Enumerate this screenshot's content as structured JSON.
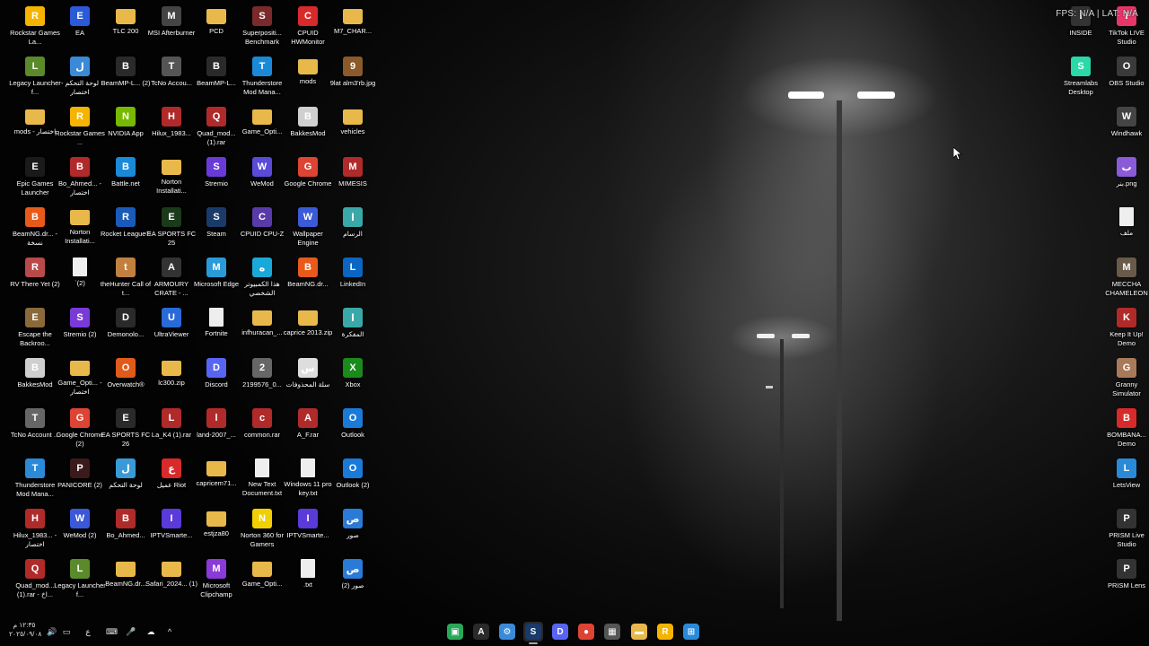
{
  "overlay": {
    "text": "FPS: N/A  |  LAT: N/A"
  },
  "desktop": {
    "left_columns": [
      [
        "Rockstar Games La...",
        "Legacy Launcher f...",
        "mods - اختصار",
        "Epic Games Launcher",
        "BeamNG.dr... - نسخة",
        "RV There Yet (2)",
        "Escape the Backroo...",
        "BakkesMod",
        "TcNo Account ...",
        "Thunderstore Mod Mana...",
        "Hilux_1983... - اختصار",
        "Quad_mod... (1).rar - اخ..."
      ],
      [
        "EA",
        "لوحة التحكم - اختصار",
        "Rockstar Games ...",
        "Bo_Ahmed... - اختصار",
        "Norton Installati...",
        "`(2)",
        "Stremio (2)",
        "Game_Opti... - اختصار",
        "Google Chrome (2)",
        "PANICORE (2)",
        "WeMod (2)",
        "Legacy Launcher f..."
      ],
      [
        "TLC 200",
        "BeamMP-L... (2)",
        "NVIDIA App",
        "Battle.net",
        "Rocket League®",
        "theHunter Call of t...",
        "Demonolo...",
        "Overwatch®",
        "EA SPORTS FC 26",
        "لوحة التحكم",
        "Bo_Ahmed...",
        "BeamNG.dr..."
      ],
      [
        "MSI Afterburner",
        "TcNo Accou...",
        "Hilux_1983...",
        "Norton Installati...",
        "EA SPORTS FC 25",
        "ARMOURY CRATE - ...",
        "UltraViewer",
        "lc300.zip",
        "La_K4 (1).rar",
        "عميل Riot",
        "IPTVSmarte...",
        "Safari_2024... (1)"
      ],
      [
        "PCD",
        "BeamMP-L...",
        "Quad_mod... (1).rar",
        "Stremio",
        "Steam",
        "Microsoft Edge",
        "Fortnite",
        "Discord",
        "land-2007_...",
        "capricem71...",
        "estjza80",
        "Microsoft Clipchamp"
      ],
      [
        "Superpositi... Benchmark",
        "Thunderstore Mod Mana...",
        "Game_Opti...",
        "WeMod",
        "CPUID CPU-Z",
        "هذا الكمبيوتر الشخصي",
        "infhuracan_...",
        "2199576_0...",
        "common.rar",
        "New Text Document.txt",
        "Norton 360 for Gamers",
        "Game_Opti..."
      ],
      [
        "CPUID HWMonitor",
        "mods",
        "BakkesMod",
        "Google Chrome",
        "Wallpaper Engine",
        "BeamNG.dr...",
        "caprice 2013.zip",
        "سلة المحذوفات",
        "A_F.rar",
        "Windows 11 pro key.txt",
        "IPTVSmarte...",
        ".txt"
      ],
      [
        "M7_CHAR...",
        "9lat alm3'rb.jpg",
        "vehicles",
        "MIMESIS",
        "الرسام",
        "LinkedIn",
        "المفكرة",
        "Xbox",
        "Outlook",
        "Outlook (2)",
        "صور",
        "صور (2)"
      ]
    ],
    "left_colors": [
      [
        "#f5b400",
        "#5a8a2a",
        "#e8b94a",
        "#1a1a1a",
        "#e85a1a",
        "#b84a4a",
        "#8a6a3a",
        "#cfcfcf",
        "#666",
        "#2a8ad8",
        "#b02a2a",
        "#b02a2a"
      ],
      [
        "#2a5ad8",
        "#3a8ad8",
        "#f5b400",
        "#b02a2a",
        "#e8b94a",
        "#eeeeee",
        "#7a3ad8",
        "#e8b94a",
        "#dd4433",
        "#3a1a1a",
        "#3a58d8",
        "#5a8a2a"
      ],
      [
        "#e8b94a",
        "#2a2a2a",
        "#76b900",
        "#1a8ad8",
        "#1a5ab8",
        "#c08040",
        "#2a2a2a",
        "#e05a1a",
        "#2a2a2a",
        "#3a9ad8",
        "#b02a2a",
        "#e8b94a"
      ],
      [
        "#444",
        "#555",
        "#b02a2a",
        "#e8b94a",
        "#1a3a1a",
        "#333",
        "#2a6ad8",
        "#e8b94a",
        "#b02a2a",
        "#d82a2a",
        "#5a3ad8",
        "#e8b94a"
      ],
      [
        "#e8b94a",
        "#2a2a2a",
        "#b02a2a",
        "#6a3ad8",
        "#1a3a6a",
        "#2a9ad8",
        "#eeeeee",
        "#5865f2",
        "#b02a2a",
        "#e8b94a",
        "#e8b94a",
        "#8a3ad8"
      ],
      [
        "#7a2a2a",
        "#1a8ad8",
        "#e8b94a",
        "#5a4ad8",
        "#5a3aa8",
        "#1aa8d8",
        "#e8b94a",
        "#666",
        "#b02a2a",
        "#eeeeee",
        "#f0d000",
        "#e8b94a"
      ],
      [
        "#d82a2a",
        "#e8b94a",
        "#cfcfcf",
        "#dd4433",
        "#3a5ad8",
        "#e85a1a",
        "#e8b94a",
        "#dddddd",
        "#b02a2a",
        "#eeeeee",
        "#5a3ad8",
        "#eeeeee"
      ],
      [
        "#e8b94a",
        "#8a5a2a",
        "#e8b94a",
        "#b02a2a",
        "#3aa8a8",
        "#0a66c2",
        "#3aa8a8",
        "#1a8a1a",
        "#1a7ad8",
        "#1a7ad8",
        "#2a7ad8",
        "#2a7ad8"
      ]
    ],
    "right_column": [
      "INSIDE",
      "Streamlabs Desktop",
      "Windhawk",
      "بنر.png",
      "ملف",
      "MECCHA CHAMELEON",
      "Keep It Up! Demo",
      "Granny Simulator",
      "BOMBANA... Demo",
      "LetsView",
      "PRISM Live Studio",
      "PRISM Lens"
    ],
    "right_column_2": [
      "TikTok LIVE Studio",
      "OBS Studio"
    ],
    "right_colors": [
      "#333",
      "#2ad8a8",
      "#444",
      "#8a5ad8",
      "#eeeeee",
      "#6a5a4a",
      "#b02a2a",
      "#a87a5a",
      "#d82a2a",
      "#2a8ad8",
      "#333",
      "#333"
    ],
    "right_colors_2": [
      "#e8356a",
      "#3a3a3a"
    ]
  },
  "taskbar": {
    "clock_time": "١٢:٣٥ م",
    "clock_date": "٢٠٢٥/٠٩/٠٨",
    "tray": {
      "volume": "🔊",
      "display": "▭",
      "lang": "ع",
      "network": "⌨",
      "mic": "🎤",
      "cloud": "☁",
      "chevron": "^"
    },
    "pinned": [
      {
        "name": "taskbar-app-1",
        "glyph": "▣",
        "color": "#2aa85a"
      },
      {
        "name": "taskbar-app-2",
        "glyph": "A",
        "color": "#2a2a2a"
      },
      {
        "name": "taskbar-app-3",
        "glyph": "⚙",
        "color": "#3a8ad8"
      },
      {
        "name": "taskbar-steam",
        "glyph": "S",
        "color": "#1a3a6a"
      },
      {
        "name": "taskbar-discord",
        "glyph": "D",
        "color": "#5865f2"
      },
      {
        "name": "taskbar-chrome",
        "glyph": "●",
        "color": "#dd4433"
      },
      {
        "name": "taskbar-store",
        "glyph": "▦",
        "color": "#555"
      },
      {
        "name": "taskbar-explorer",
        "glyph": "▬",
        "color": "#e8b94a"
      },
      {
        "name": "taskbar-rockstar",
        "glyph": "R",
        "color": "#f5b400"
      },
      {
        "name": "taskbar-start",
        "glyph": "⊞",
        "color": "#2a8ad8"
      }
    ]
  }
}
